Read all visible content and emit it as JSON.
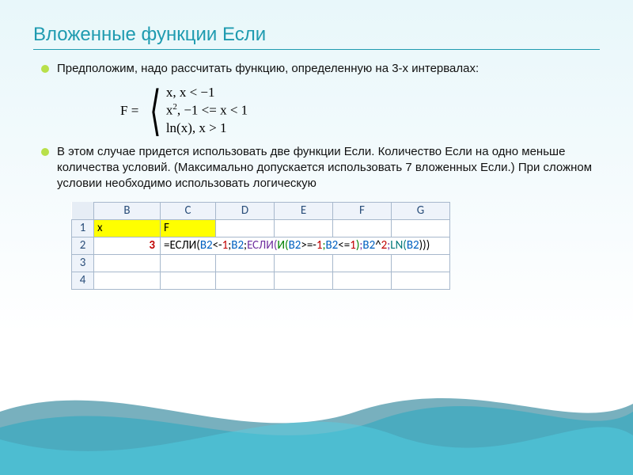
{
  "title": "Вложенные функции Если",
  "bullets": {
    "b1": "Предположим, надо рассчитать функцию, определенную на 3-х интервалах:",
    "b2": "В этом случае придется использовать две функции Если. Количество Если на одно меньше количества условий. (Максимально допускается использовать 7 вложенных Если.) При сложном условии необходимо использовать логическую"
  },
  "formula": {
    "lhs": "F =",
    "case1": "x,  x < −1",
    "case2_a": "x",
    "case2_b": ", −1 <= x < 1",
    "case3": "ln(x), x > 1"
  },
  "sheet": {
    "cols": {
      "B": "B",
      "C": "C",
      "D": "D",
      "E": "E",
      "F": "F",
      "G": "G"
    },
    "rows": {
      "r1": "1",
      "r2": "2",
      "r3": "3",
      "r4": "4"
    },
    "A1": "x",
    "B1": "F",
    "A2": "3",
    "formula_tokens": {
      "eq": "=",
      "if1": "ЕСЛИ(",
      "ref1": "B2",
      "lt": "<-",
      "neg1": "1",
      "sep1": ";",
      "ref2": "B2",
      "sep2": ";",
      "if2": "ЕСЛИ(",
      "and": "И(",
      "ref3": "B2",
      "ge": ">=-",
      "one": "1",
      "sep3": ";",
      "ref4": "B2",
      "le": "<=",
      "one2": "1",
      "cparen1": ")",
      "sep4": ";",
      "ref5": "B2",
      "pow": "^",
      "two": "2",
      "sep5": ";",
      "ln": "LN(",
      "ref6": "B2",
      "cparen2": ")))"
    }
  }
}
